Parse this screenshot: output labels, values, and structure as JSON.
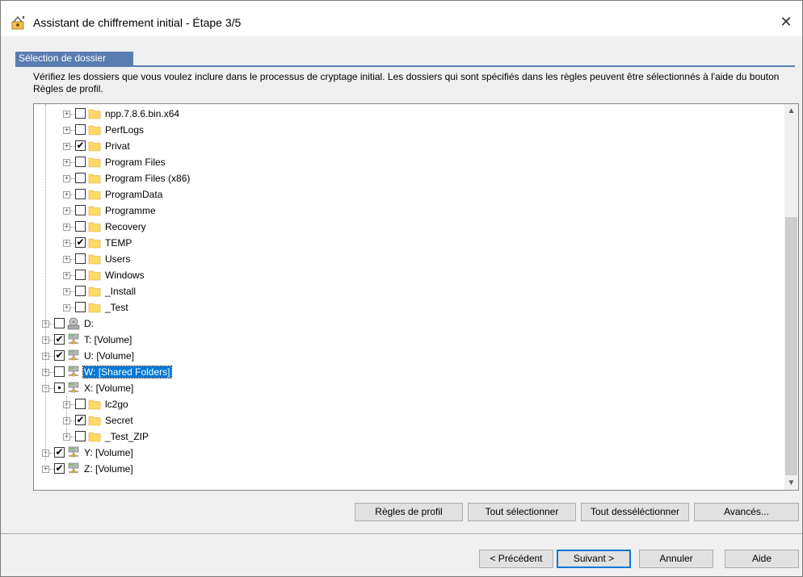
{
  "window": {
    "title": "Assistant de chiffrement initial - Étape 3/5",
    "close": "✕"
  },
  "section": {
    "tab_label": "Sélection de dossier",
    "description": "Vérifiez les dossiers que vous voulez inclure dans le processus de cryptage initial. Les dossiers qui sont spécifiés dans les règles peuvent être sélectionnés à l'aide du bouton Règles de profil."
  },
  "tree": {
    "items": [
      {
        "label": "npp.7.8.6.bin.x64",
        "checked": false,
        "icon": "folder-icon",
        "level": 2
      },
      {
        "label": "PerfLogs",
        "checked": false,
        "icon": "folder-icon",
        "level": 2
      },
      {
        "label": "Privat",
        "checked": true,
        "icon": "folder-icon",
        "level": 2
      },
      {
        "label": "Program Files",
        "checked": false,
        "icon": "folder-icon",
        "level": 2
      },
      {
        "label": "Program Files (x86)",
        "checked": false,
        "icon": "folder-icon",
        "level": 2
      },
      {
        "label": "ProgramData",
        "checked": false,
        "icon": "folder-icon",
        "level": 2
      },
      {
        "label": "Programme",
        "checked": false,
        "icon": "folder-icon",
        "level": 2
      },
      {
        "label": "Recovery",
        "checked": false,
        "icon": "folder-icon",
        "level": 2
      },
      {
        "label": "TEMP",
        "checked": true,
        "icon": "folder-icon",
        "level": 2
      },
      {
        "label": "Users",
        "checked": false,
        "icon": "folder-icon",
        "level": 2
      },
      {
        "label": "Windows",
        "checked": false,
        "icon": "folder-icon",
        "level": 2
      },
      {
        "label": "_Install",
        "checked": false,
        "icon": "folder-icon",
        "level": 2
      },
      {
        "label": "_Test",
        "checked": false,
        "icon": "folder-icon",
        "level": 2
      },
      {
        "label": "D:",
        "checked": false,
        "icon": "drive-icon",
        "level": 1
      },
      {
        "label": "T: [Volume]",
        "checked": true,
        "icon": "network-drive-icon",
        "level": 1
      },
      {
        "label": "U: [Volume]",
        "checked": true,
        "icon": "network-drive-icon",
        "level": 1
      },
      {
        "label": "W: [Shared Folders]",
        "checked": false,
        "icon": "network-drive-icon",
        "level": 1,
        "selected": true
      },
      {
        "label": "X: [Volume]",
        "checked": "partial",
        "icon": "network-drive-icon",
        "level": 1,
        "expanded": true
      },
      {
        "label": "lc2go",
        "checked": false,
        "icon": "folder-icon",
        "level": 2
      },
      {
        "label": "Secret",
        "checked": true,
        "icon": "folder-icon",
        "level": 2
      },
      {
        "label": "_Test_ZIP",
        "checked": false,
        "icon": "folder-icon",
        "level": 2
      },
      {
        "label": "Y: [Volume]",
        "checked": true,
        "icon": "network-drive-icon",
        "level": 1
      },
      {
        "label": "Z: [Volume]",
        "checked": true,
        "icon": "network-drive-icon",
        "level": 1
      }
    ]
  },
  "actions": {
    "profile_rules": "Règles de profil",
    "select_all": "Tout sélectionner",
    "deselect_all": "Tout desséléctionner",
    "advanced": "Avancés..."
  },
  "nav": {
    "previous": "< Précédent",
    "next": "Suivant >",
    "cancel": "Annuler",
    "help": "Aide"
  },
  "colors": {
    "accent": "#5a7db1",
    "selection": "#0078d7",
    "folder": "#ffd966"
  }
}
